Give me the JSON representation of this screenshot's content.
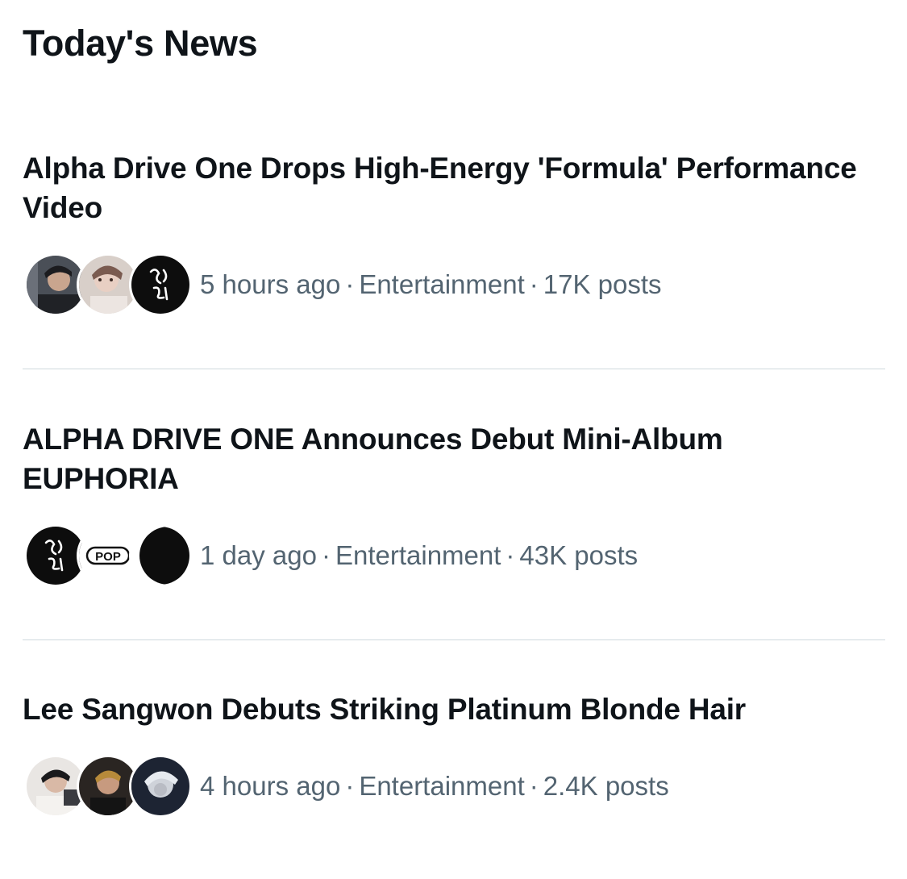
{
  "section": {
    "title": "Today's News"
  },
  "items": [
    {
      "headline": "Alpha Drive One Drops High-Energy 'Formula' Performance Video",
      "time": "5 hours ago",
      "category": "Entertainment",
      "posts": "17K posts",
      "avatars": [
        "person-photo-avatar",
        "person-photo-avatar",
        "logo-avatar"
      ]
    },
    {
      "headline": "ALPHA DRIVE ONE Announces Debut Mini-Album EUPHORIA",
      "time": "1 day ago",
      "category": "Entertainment",
      "posts": "43K posts",
      "avatars": [
        "logo-avatar",
        "pop-logo-avatar",
        "dark-avatar"
      ],
      "pop_logo_text": "POP"
    },
    {
      "headline": "Lee Sangwon Debuts Striking Platinum Blonde Hair",
      "time": "4 hours ago",
      "category": "Entertainment",
      "posts": "2.4K posts",
      "avatars": [
        "person-photo-avatar",
        "person-photo-avatar",
        "person-photo-avatar"
      ]
    }
  ],
  "separator": "·",
  "colors": {
    "text_primary": "#0f1419",
    "text_secondary": "#536471",
    "divider": "#cfd9de",
    "background": "#ffffff"
  }
}
